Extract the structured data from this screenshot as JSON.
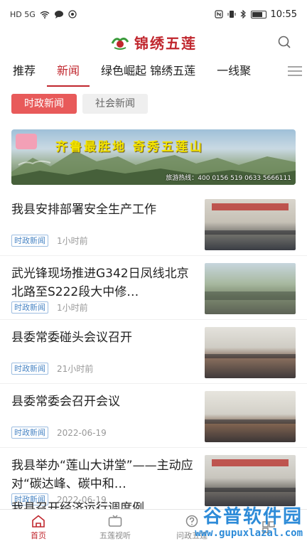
{
  "status_bar": {
    "time": "10:55",
    "network": "HD 5G",
    "battery_icon": "battery-icon"
  },
  "app": {
    "name": "锦绣五莲",
    "brand_color": "#c0262d"
  },
  "channel_tabs": [
    {
      "label": "推荐",
      "active": false
    },
    {
      "label": "新闻",
      "active": true
    },
    {
      "label": "绿色崛起 锦绣五莲",
      "active": false
    },
    {
      "label": "一线聚",
      "active": false
    }
  ],
  "sub_tabs": [
    {
      "label": "时政新闻",
      "active": true
    },
    {
      "label": "社会新闻",
      "active": false
    }
  ],
  "banner": {
    "slogan": "齐鲁最胜地 奇秀五莲山",
    "hotline": "旅游热线：400 0156 519   0633 5666111"
  },
  "news": [
    {
      "title": "我县安排部署安全生产工作",
      "tag": "时政新闻",
      "time": "1小时前"
    },
    {
      "title": "武光锋现场推进G342日凤线北京北路至S222段大中修…",
      "tag": "时政新闻",
      "time": "1小时前"
    },
    {
      "title": "县委常委碰头会议召开",
      "tag": "时政新闻",
      "time": "21小时前"
    },
    {
      "title": "县委常委会召开会议",
      "tag": "时政新闻",
      "time": "2022-06-19"
    },
    {
      "title": "我县举办“莲山大讲堂”——主动应对“碳达峰、碳中和…",
      "tag": "时政新闻",
      "time": "2022-06-19"
    }
  ],
  "partial_news_title": "我县召开经济运行调度例",
  "bottom_nav": [
    {
      "label": "首页",
      "icon": "home-icon",
      "active": true
    },
    {
      "label": "五莲视听",
      "icon": "tv-icon",
      "active": false
    },
    {
      "label": "问政五莲",
      "icon": "question-icon",
      "active": false
    },
    {
      "label": "",
      "icon": "service-icon",
      "active": false
    }
  ],
  "watermark": {
    "top": "谷普软件园",
    "bottom": "www.gupuxlazal.com"
  }
}
